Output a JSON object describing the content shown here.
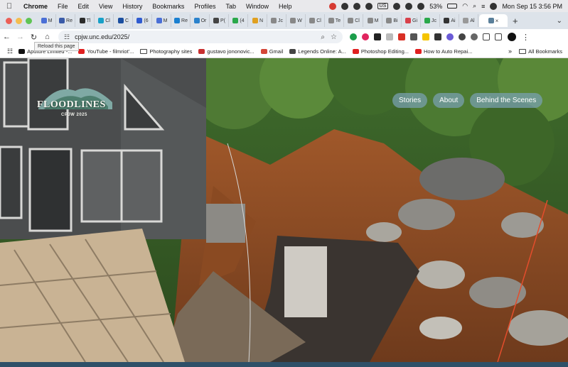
{
  "menubar": {
    "items": [
      "Chrome",
      "File",
      "Edit",
      "View",
      "History",
      "Bookmarks",
      "Profiles",
      "Tab",
      "Window",
      "Help"
    ],
    "input_source": "US",
    "battery": "53%",
    "clock": "Mon Sep 15  3:56 PM"
  },
  "tabs": [
    {
      "label": "M",
      "color": "#4a6fd6"
    },
    {
      "label": "Re",
      "color": "#3a5ba8"
    },
    {
      "label": "Tl",
      "color": "#2b2b2b"
    },
    {
      "label": "Cl",
      "color": "#18a0c8"
    },
    {
      "label": "C",
      "color": "#1b4fa0"
    },
    {
      "label": "(6",
      "color": "#2f5bd0"
    },
    {
      "label": "M",
      "color": "#4a6fd6"
    },
    {
      "label": "Re",
      "color": "#1a7fd0"
    },
    {
      "label": "Or",
      "color": "#2a82cc"
    },
    {
      "label": "P(",
      "color": "#444"
    },
    {
      "label": "(4",
      "color": "#2aa84a"
    },
    {
      "label": "N",
      "color": "#e0a020"
    },
    {
      "label": "Jc",
      "color": "#888"
    },
    {
      "label": "W",
      "color": "#888"
    },
    {
      "label": "Cl",
      "color": "#888"
    },
    {
      "label": "Te",
      "color": "#888"
    },
    {
      "label": "Cl",
      "color": "#888"
    },
    {
      "label": "M",
      "color": "#888"
    },
    {
      "label": "Bi",
      "color": "#888"
    },
    {
      "label": "Gi",
      "color": "#d8404a"
    },
    {
      "label": "Jc",
      "color": "#2aa84a"
    },
    {
      "label": "Ai",
      "color": "#333"
    },
    {
      "label": "Al",
      "color": "#999"
    }
  ],
  "active_tab": {
    "close": "×"
  },
  "toolbar": {
    "url": "cpjw.unc.edu/2025/",
    "tooltip": "Reload this page"
  },
  "bookmarks": {
    "items": [
      {
        "label": "Aputure Limited -...",
        "color": "#111"
      },
      {
        "label": "YouTube - filmriot'...",
        "color": "#e02020"
      },
      {
        "label": "Photography sites",
        "folder": true
      },
      {
        "label": "gustavo jononovic...",
        "color": "#c83030"
      },
      {
        "label": "Gmail",
        "color": "#d44638"
      },
      {
        "label": "Legends Online: A...",
        "color": "#444"
      },
      {
        "label": "Photoshop Editing...",
        "color": "#e02020"
      },
      {
        "label": "How to Auto Repai...",
        "color": "#e02020"
      }
    ],
    "more": "»",
    "all": "All Bookmarks"
  },
  "site": {
    "logo_title": "FLOODLINES",
    "logo_sub": "CPJW 2025",
    "nav": [
      "Stories",
      "About",
      "Behind the Scenes"
    ]
  }
}
